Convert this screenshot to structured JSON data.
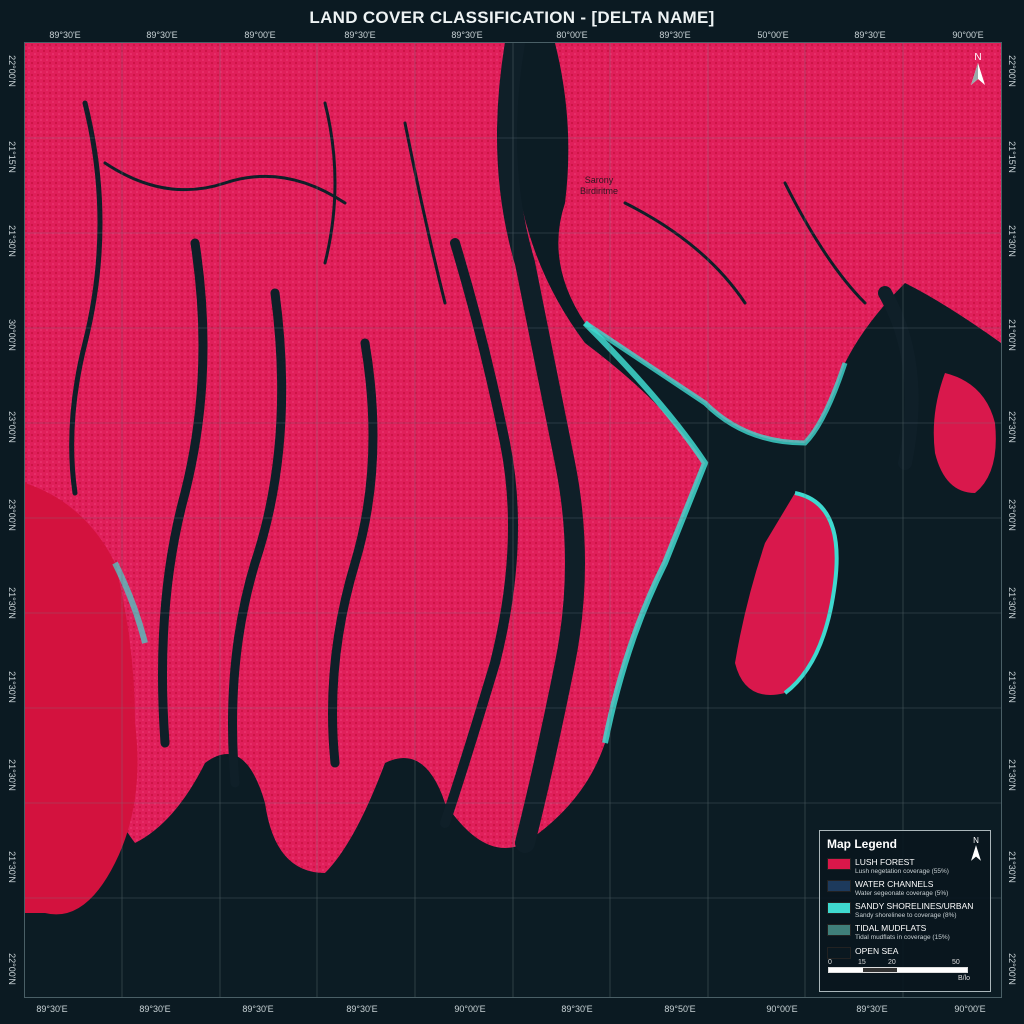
{
  "title": "LAND COVER CLASSIFICATION - [DELTA NAME]",
  "top_ticks": [
    "89°30'E",
    "89°30'E",
    "89°00'E",
    "89°30'E",
    "89°30'E",
    "80°00'E",
    "89°30'E",
    "50°00'E",
    "89°30'E",
    "90°00'E"
  ],
  "bottom_ticks": [
    "89°30'E",
    "89°30'E",
    "89°30'E",
    "89°30'E",
    "90°00'E",
    "89°30'E",
    "89°50'E",
    "90°00'E",
    "89°30'E",
    "90°00'E"
  ],
  "left_ticks": [
    "22°00'N",
    "21°15'N",
    "21°30'N",
    "30°00'N",
    "23°00'N",
    "23°00'N",
    "21°30'N",
    "21°30'N",
    "21°30'N",
    "21°30'N",
    "22°00'N"
  ],
  "right_ticks": [
    "22°00'N",
    "21°15'N",
    "21°30'N",
    "21°00'N",
    "22°30'N",
    "23°00'N",
    "21°30'N",
    "21°30'N",
    "21°30'N",
    "21°30'N",
    "22°00'N"
  ],
  "place_label": "Sarony\nBirdiritme",
  "north_label": "N",
  "colors": {
    "forest": "#e0174f",
    "water": "#10222c",
    "shore": "#3fd9cf",
    "mudflat": "#3f7f7a",
    "sea": "#0b1a22"
  },
  "legend": {
    "title": "Map Legend",
    "items": [
      {
        "label": "LUSH FOREST",
        "sub": "Lush negetation coverage (55%)",
        "color": "#d9174a"
      },
      {
        "label": "WATER CHANNELS",
        "sub": "Water segeonate coverage (5%)",
        "color": "#1d3a5c"
      },
      {
        "label": "SANDY SHORELINES/URBAN",
        "sub": "Sandy shorelinee to coverage (8%)",
        "color": "#3fd9cf"
      },
      {
        "label": "TIDAL MUDFLATS",
        "sub": "Tidal mudflats in coverage (15%)",
        "color": "#3f7f7a"
      },
      {
        "label": "OPEN SEA",
        "sub": "",
        "color": "#0a1820"
      }
    ],
    "scale_labels": [
      "0",
      "15",
      "20",
      "50"
    ],
    "scale_unit": "B/lo"
  }
}
